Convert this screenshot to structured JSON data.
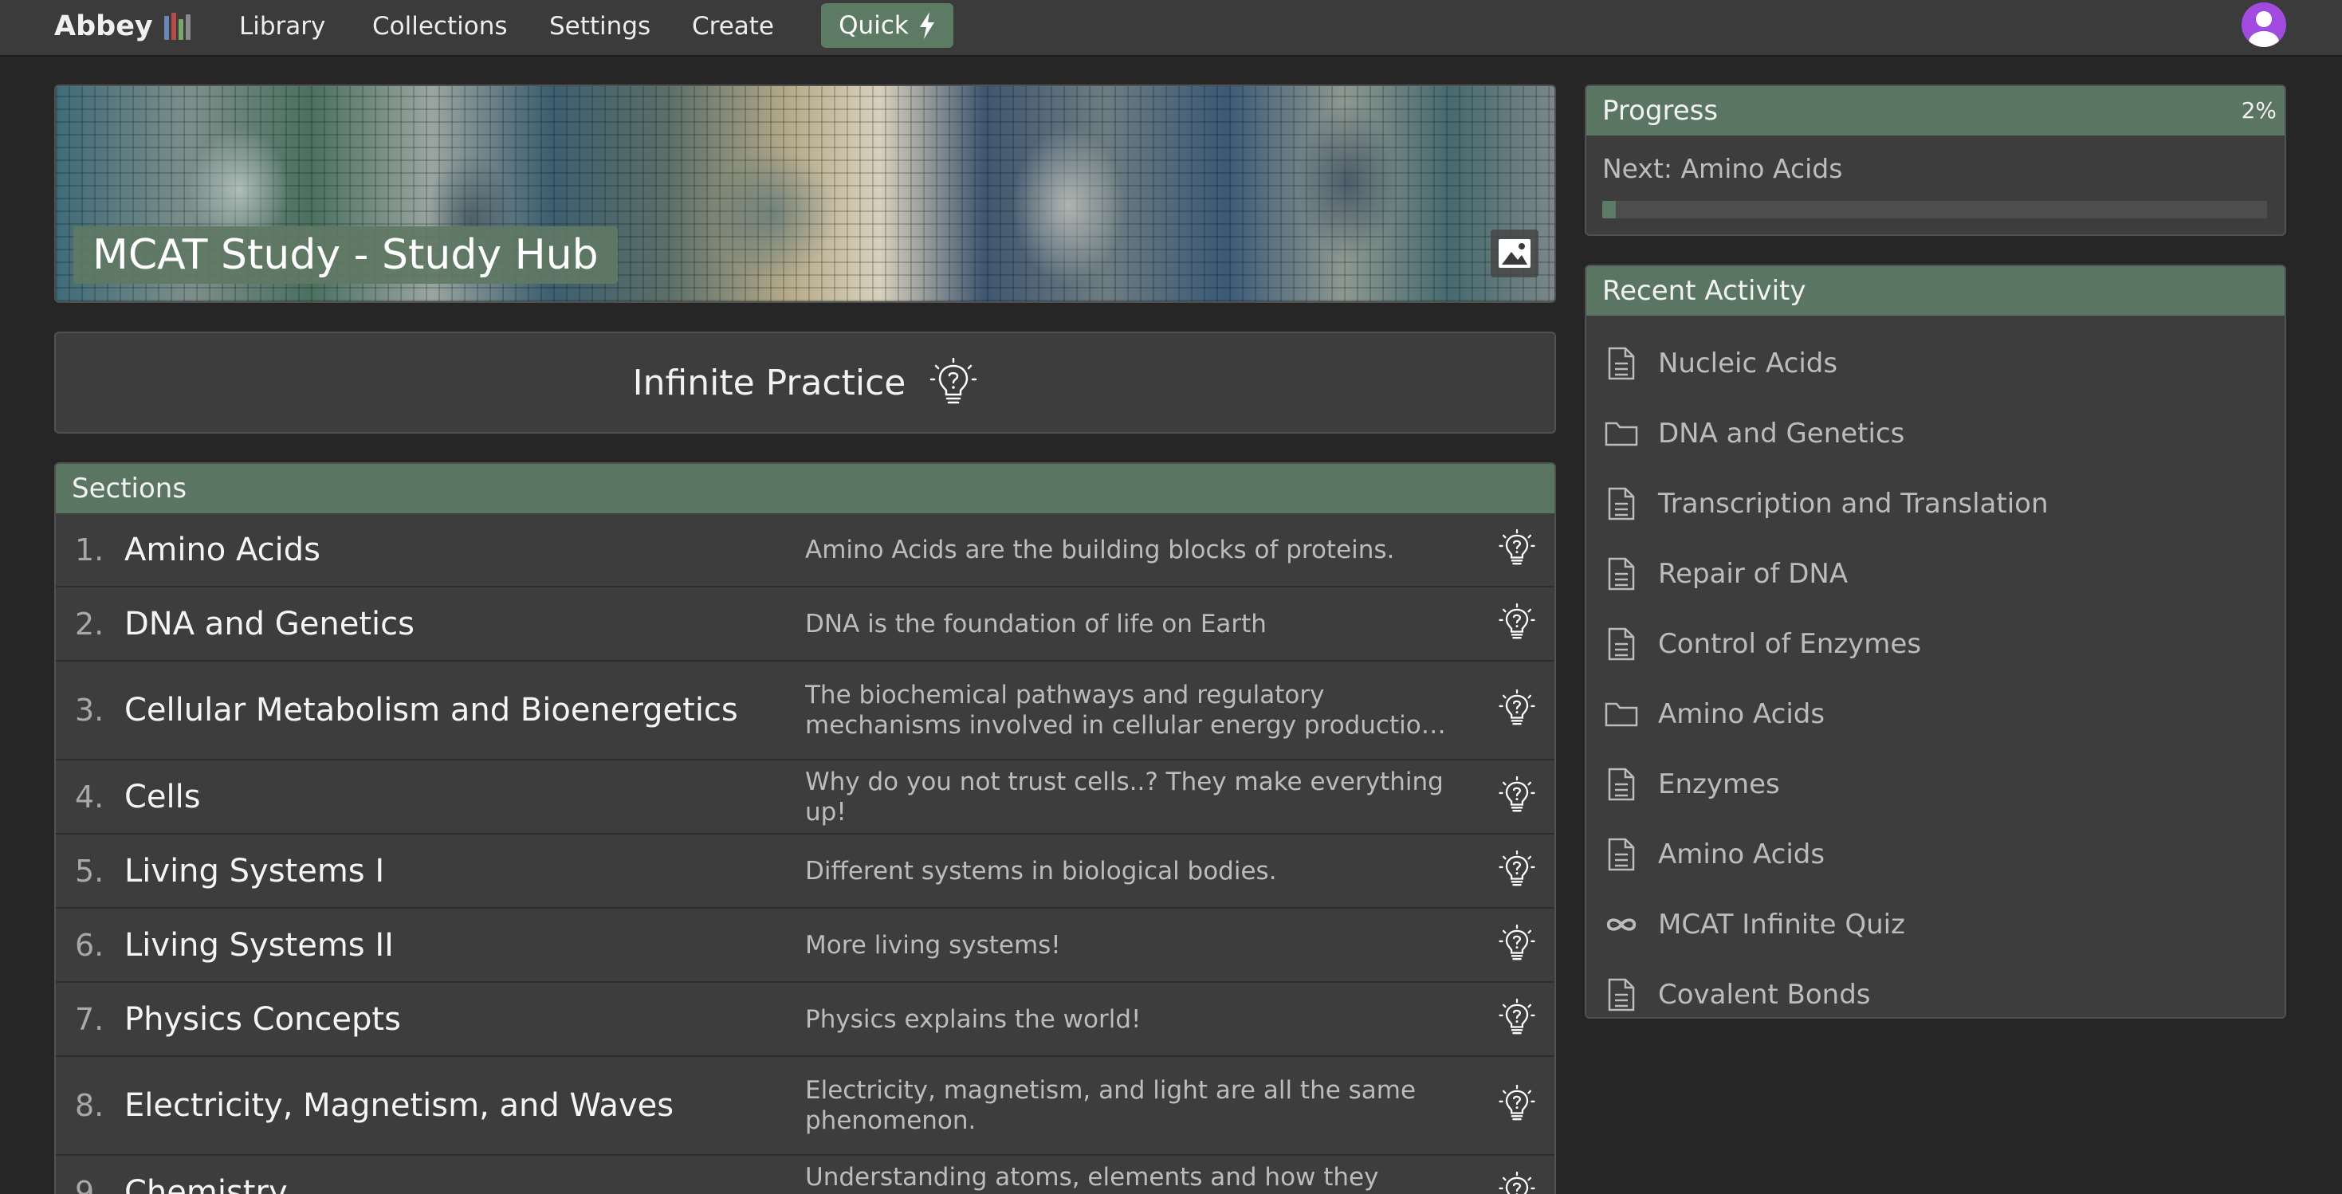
{
  "nav": {
    "brand": "Abbey",
    "brand_icon": "books-icon",
    "links": [
      "Library",
      "Collections",
      "Settings",
      "Create"
    ],
    "quick_label": "Quick",
    "quick_icon": "lightning-icon",
    "avatar_icon": "user-avatar-icon",
    "accent": "#5d7a64",
    "avatar_color": "#a24be0"
  },
  "hero": {
    "title": "MCAT Study - Study Hub",
    "image_icon": "image-icon"
  },
  "practice": {
    "label": "Infinite Practice",
    "icon": "lightbulb-question-icon"
  },
  "sections": {
    "header": "Sections",
    "items": [
      {
        "num": "1.",
        "title": "Amino Acids",
        "desc": "Amino Acids are the building blocks of proteins."
      },
      {
        "num": "2.",
        "title": "DNA and Genetics",
        "desc": "DNA is the foundation of life on Earth"
      },
      {
        "num": "3.",
        "title": "Cellular Metabolism and Bioenergetics",
        "desc": "The biochemical pathways and regulatory mechanisms involved in cellular energy production and utilization,..."
      },
      {
        "num": "4.",
        "title": "Cells",
        "desc": "Why do you not trust cells..? They make everything up!"
      },
      {
        "num": "5.",
        "title": "Living Systems I",
        "desc": "Different systems in biological bodies."
      },
      {
        "num": "6.",
        "title": "Living Systems II",
        "desc": "More living systems!"
      },
      {
        "num": "7.",
        "title": "Physics Concepts",
        "desc": "Physics explains the world!"
      },
      {
        "num": "8.",
        "title": "Electricity, Magnetism, and Waves",
        "desc": "Electricity, magnetism, and light are all the same phenomenon."
      },
      {
        "num": "9.",
        "title": "Chemistry",
        "desc": "Understanding atoms, elements and how they interact"
      }
    ]
  },
  "progress": {
    "header": "Progress",
    "percent_label": "2%",
    "percent_value": 0.02,
    "next_label": "Next: Amino Acids"
  },
  "recent": {
    "header": "Recent Activity",
    "items": [
      {
        "label": "Nucleic Acids",
        "icon": "document-icon"
      },
      {
        "label": "DNA and Genetics",
        "icon": "folder-icon"
      },
      {
        "label": "Transcription and Translation",
        "icon": "document-icon"
      },
      {
        "label": "Repair of DNA",
        "icon": "document-icon"
      },
      {
        "label": "Control of Enzymes",
        "icon": "document-icon"
      },
      {
        "label": "Amino Acids",
        "icon": "folder-icon"
      },
      {
        "label": "Enzymes",
        "icon": "document-icon"
      },
      {
        "label": "Amino Acids",
        "icon": "document-icon"
      },
      {
        "label": "MCAT Infinite Quiz",
        "icon": "infinity-icon"
      },
      {
        "label": "Covalent Bonds",
        "icon": "document-icon"
      }
    ]
  }
}
